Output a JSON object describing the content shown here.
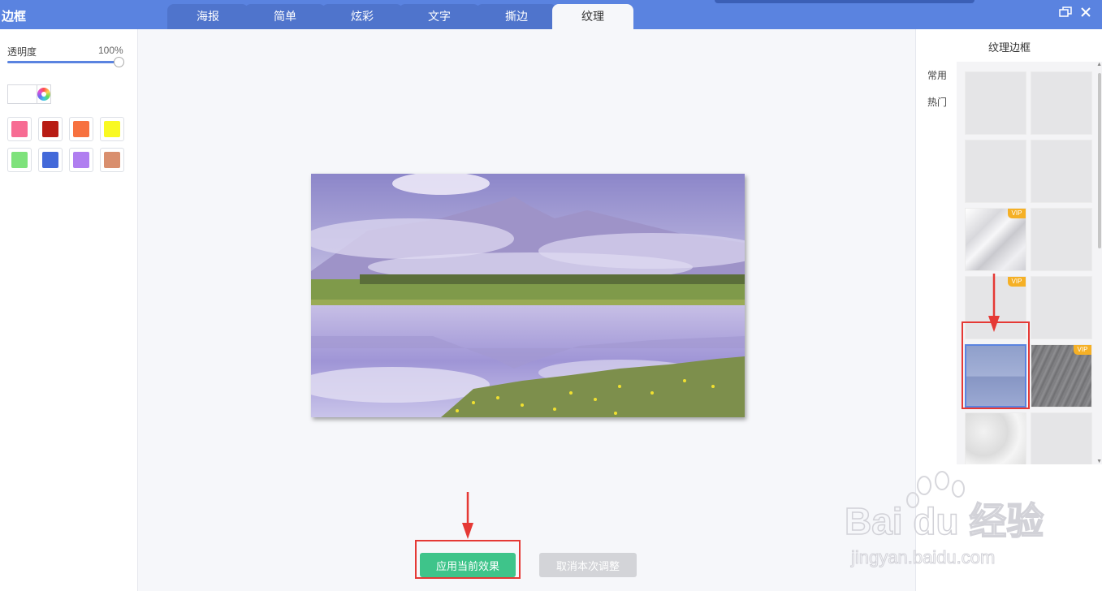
{
  "window": {
    "title": "边框",
    "restore_icon": "restore-window-icon",
    "close_icon": "close-icon"
  },
  "tabs": [
    {
      "label": "海报",
      "active": false
    },
    {
      "label": "简单",
      "active": false
    },
    {
      "label": "炫彩",
      "active": false
    },
    {
      "label": "文字",
      "active": false
    },
    {
      "label": "撕边",
      "active": false
    },
    {
      "label": "纹理",
      "active": true
    }
  ],
  "left_panel": {
    "opacity_label": "透明度",
    "opacity_value": "100%",
    "opacity_level": 1.0,
    "swatches": [
      "#f76c93",
      "#b81c14",
      "#f7713f",
      "#f9f922",
      "#7ee27b",
      "#4369d9",
      "#b07ef0",
      "#d98f6e"
    ]
  },
  "canvas": {
    "apply_button": "应用当前效果",
    "cancel_button": "取消本次调整"
  },
  "right_panel": {
    "title": "纹理边框",
    "categories": [
      "常用",
      "热门"
    ],
    "thumbnails": [
      {
        "vip": false,
        "texture": "blank"
      },
      {
        "vip": false,
        "texture": "blank"
      },
      {
        "vip": false,
        "texture": "blank"
      },
      {
        "vip": false,
        "texture": "blank"
      },
      {
        "vip": true,
        "texture": "white-fold"
      },
      {
        "vip": false,
        "texture": "blank"
      },
      {
        "vip": true,
        "texture": "blank"
      },
      {
        "vip": false,
        "texture": "blank"
      },
      {
        "vip": false,
        "texture": "blue-paper",
        "selected": true
      },
      {
        "vip": true,
        "texture": "gray-brushed"
      },
      {
        "vip": false,
        "texture": "white-grunge"
      },
      {
        "vip": false,
        "texture": "blank"
      }
    ],
    "vip_label": "VIP"
  },
  "colors": {
    "titlebar": "#5a83e0",
    "apply_green": "#3ec48a",
    "highlight_red": "#e53935"
  },
  "watermark": {
    "brand": "Bai du 经验",
    "url": "jingyan.baidu.com"
  }
}
